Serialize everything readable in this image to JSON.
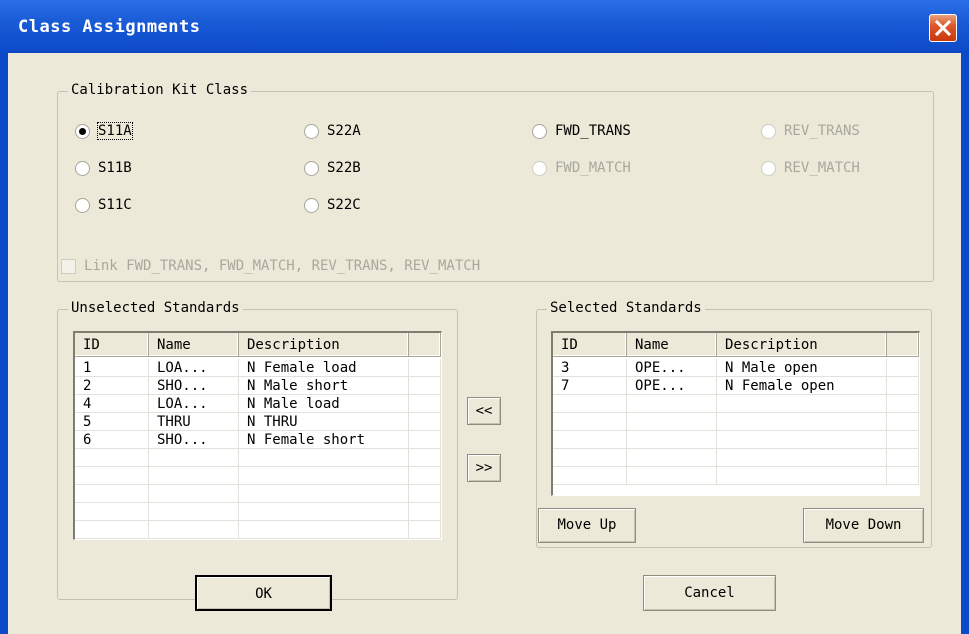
{
  "window": {
    "title": "Class Assignments"
  },
  "calibration_group": {
    "legend": "Calibration Kit Class",
    "radios": [
      {
        "label": "S11A",
        "selected": true,
        "enabled": true
      },
      {
        "label": "S11B",
        "selected": false,
        "enabled": true
      },
      {
        "label": "S11C",
        "selected": false,
        "enabled": true
      },
      {
        "label": "S22A",
        "selected": false,
        "enabled": true
      },
      {
        "label": "S22B",
        "selected": false,
        "enabled": true
      },
      {
        "label": "S22C",
        "selected": false,
        "enabled": true
      },
      {
        "label": "FWD_TRANS",
        "selected": false,
        "enabled": true
      },
      {
        "label": "FWD_MATCH",
        "selected": false,
        "enabled": false
      },
      {
        "label": "REV_TRANS",
        "selected": false,
        "enabled": false
      },
      {
        "label": "REV_MATCH",
        "selected": false,
        "enabled": false
      }
    ]
  },
  "link_checkbox": {
    "label": "Link FWD_TRANS, FWD_MATCH, REV_TRANS, REV_MATCH",
    "checked": false,
    "enabled": false
  },
  "unselected": {
    "legend": "Unselected Standards",
    "columns": [
      "ID",
      "Name",
      "Description"
    ],
    "rows": [
      {
        "id": "1",
        "name": "LOA...",
        "description": "N Female load"
      },
      {
        "id": "2",
        "name": "SHO...",
        "description": "N Male short"
      },
      {
        "id": "4",
        "name": "LOA...",
        "description": "N Male load"
      },
      {
        "id": "5",
        "name": "THRU",
        "description": "N THRU"
      },
      {
        "id": "6",
        "name": "SHO...",
        "description": "N Female short"
      }
    ]
  },
  "selected": {
    "legend": "Selected Standards",
    "columns": [
      "ID",
      "Name",
      "Description"
    ],
    "rows": [
      {
        "id": "3",
        "name": "OPE...",
        "description": "N Male open"
      },
      {
        "id": "7",
        "name": "OPE...",
        "description": "N Female open"
      }
    ]
  },
  "buttons": {
    "move_left": "<<",
    "move_right": ">>",
    "move_up": "Move Up",
    "move_down": "Move Down",
    "ok": "OK",
    "cancel": "Cancel"
  },
  "colors": {
    "titlebar": "#0c49c8",
    "dialog_bg": "#ece9d8",
    "close_button": "#e0562b",
    "disabled_text": "#a9a89e"
  }
}
